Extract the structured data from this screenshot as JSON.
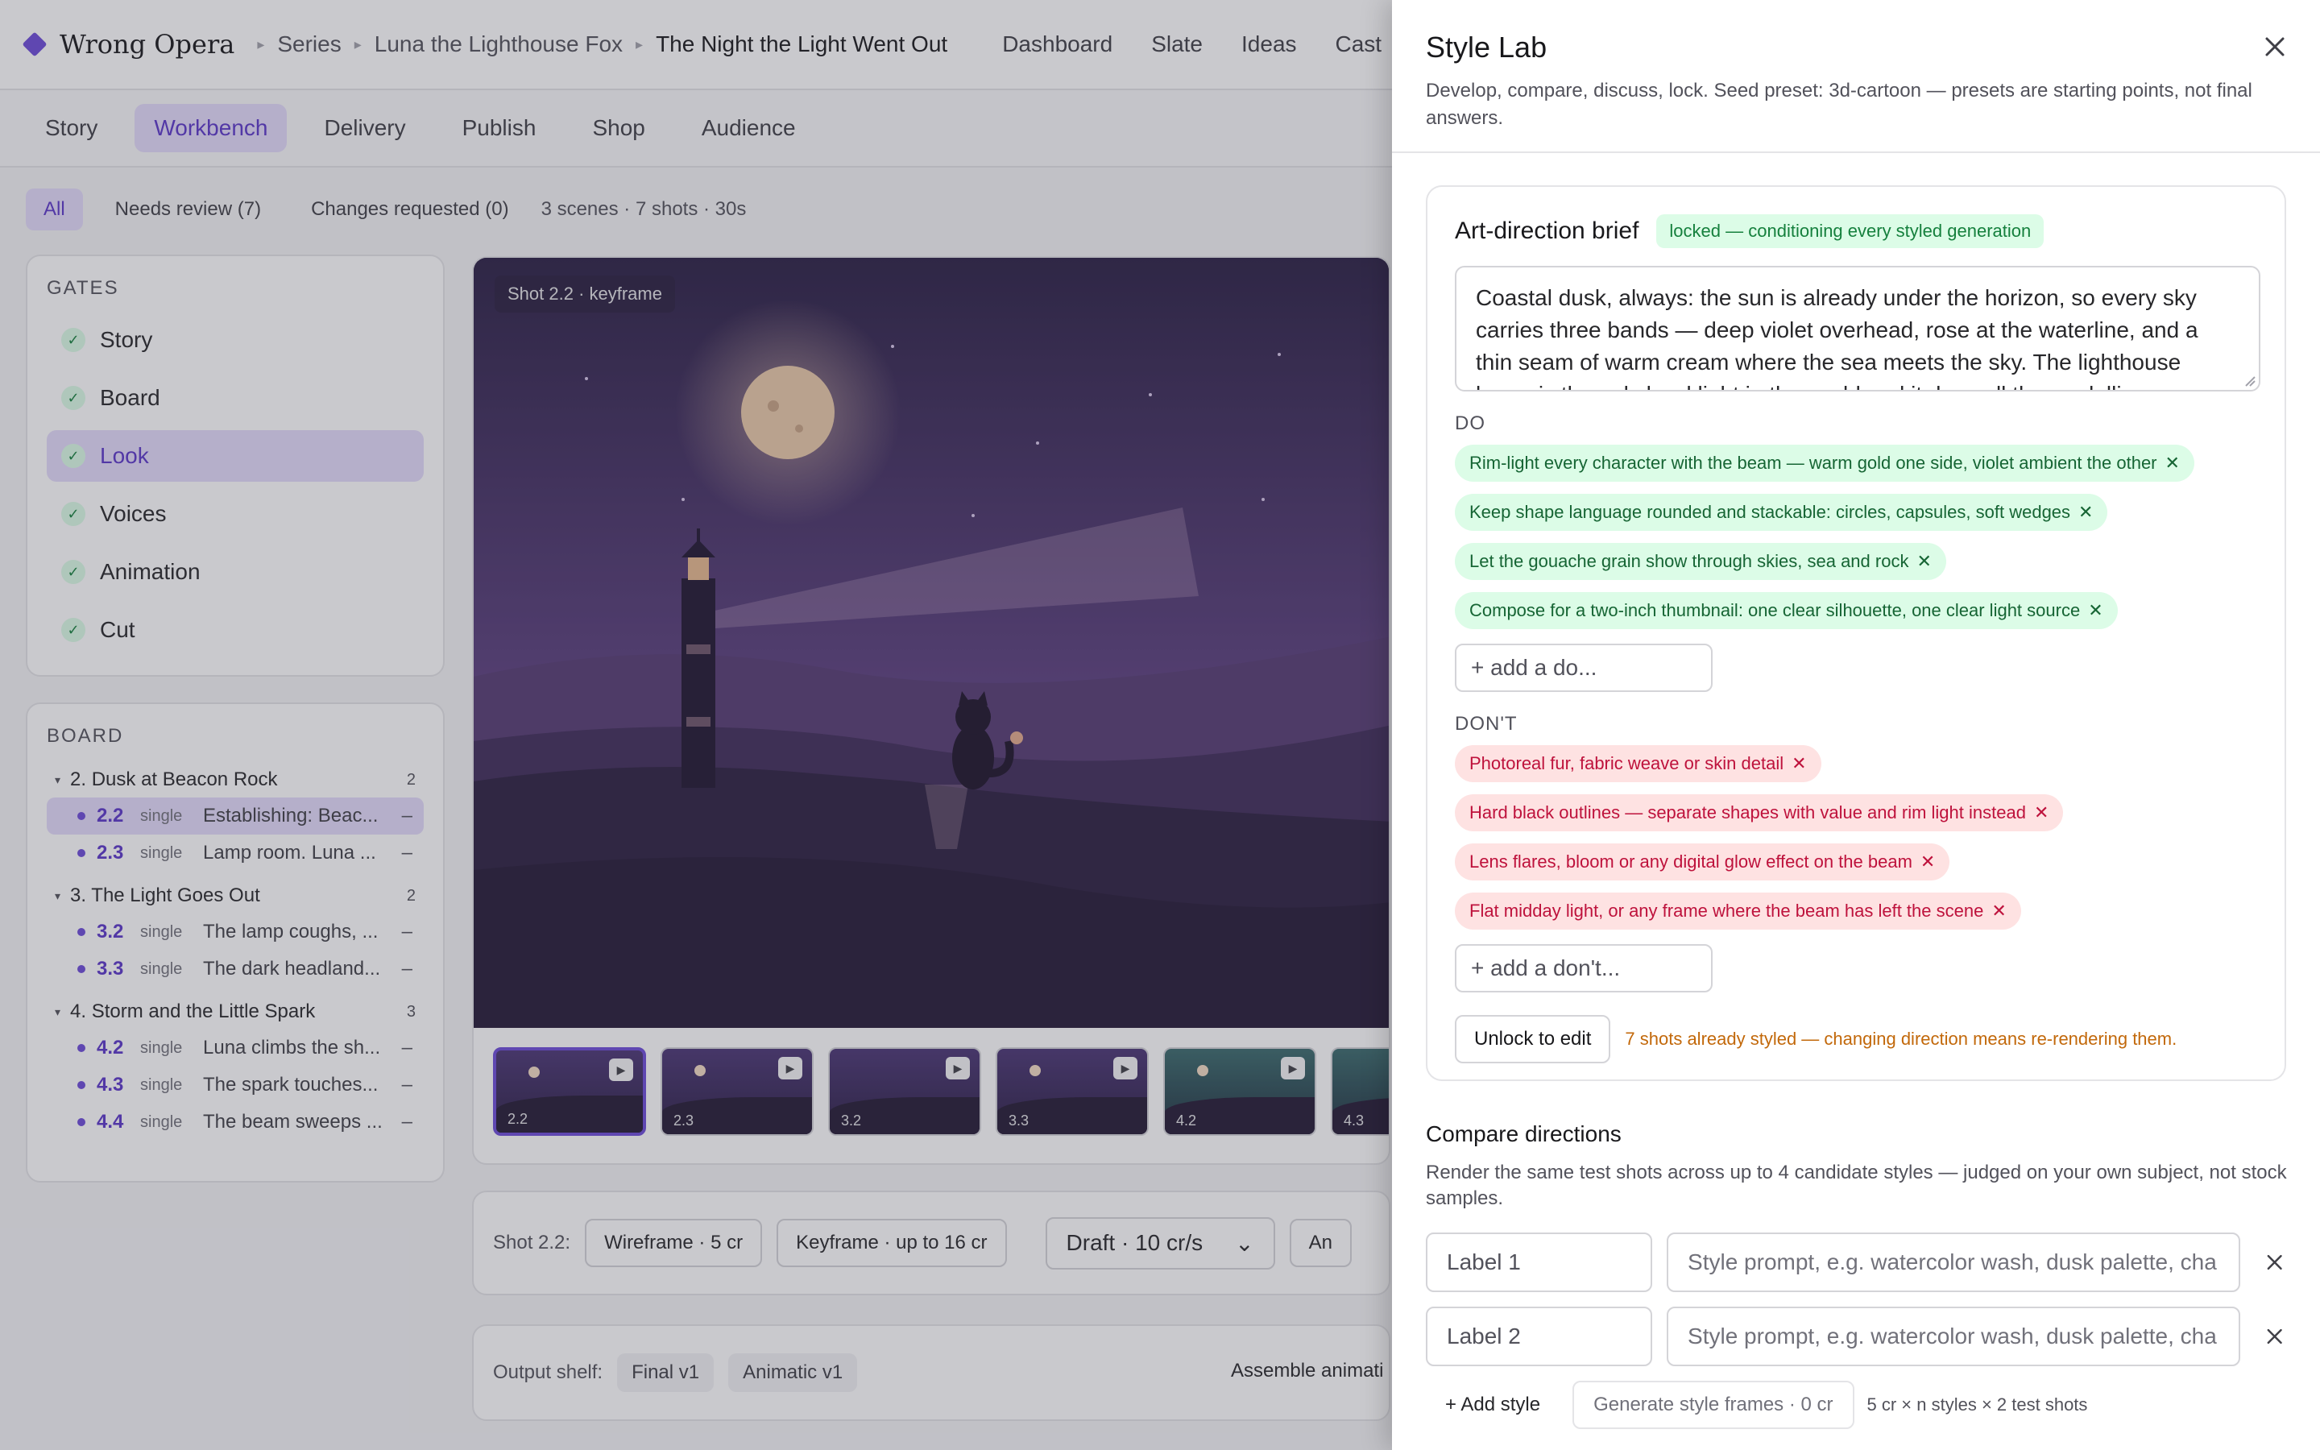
{
  "app": {
    "brand": "Wrong Opera",
    "breadcrumbs": [
      "Series",
      "Luna the Lighthouse Fox",
      "The Night the Light Went Out"
    ],
    "topnav": [
      "Dashboard",
      "Slate",
      "Ideas",
      "Cast"
    ]
  },
  "tabs": [
    "Story",
    "Workbench",
    "Delivery",
    "Publish",
    "Shop",
    "Audience"
  ],
  "filters": {
    "all": "All",
    "needs_review": "Needs review (7)",
    "changes": "Changes requested (0)",
    "meta": "3 scenes · 7 shots · 30s"
  },
  "gates": {
    "heading": "GATES",
    "items": [
      "Story",
      "Board",
      "Look",
      "Voices",
      "Animation",
      "Cut"
    ]
  },
  "board": {
    "heading": "BOARD",
    "scenes": [
      {
        "title": "2. Dusk at Beacon Rock",
        "count": "2",
        "shots": [
          {
            "id": "2.2",
            "type": "single",
            "title": "Establishing: Beac...",
            "dash": "–"
          },
          {
            "id": "2.3",
            "type": "single",
            "title": "Lamp room. Luna ...",
            "dash": "–"
          }
        ]
      },
      {
        "title": "3. The Light Goes Out",
        "count": "2",
        "shots": [
          {
            "id": "3.2",
            "type": "single",
            "title": "The lamp coughs, ...",
            "dash": "–"
          },
          {
            "id": "3.3",
            "type": "single",
            "title": "The dark headland...",
            "dash": "–"
          }
        ]
      },
      {
        "title": "4. Storm and the Little Spark",
        "count": "3",
        "shots": [
          {
            "id": "4.2",
            "type": "single",
            "title": "Luna climbs the sh...",
            "dash": "–"
          },
          {
            "id": "4.3",
            "type": "single",
            "title": "The spark touches...",
            "dash": "–"
          },
          {
            "id": "4.4",
            "type": "single",
            "title": "The beam sweeps ...",
            "dash": "–"
          }
        ]
      }
    ]
  },
  "viewer": {
    "frame_label": "Shot 2.2 · keyframe",
    "thumbs": [
      "2.2",
      "2.3",
      "3.2",
      "3.3",
      "4.2",
      "4.3"
    ]
  },
  "toolbar": {
    "label": "Shot 2.2:",
    "wireframe": "Wireframe · 5 cr",
    "keyframe": "Keyframe · up to 16 cr",
    "quality": "Draft · 10 cr/s",
    "cut": "An"
  },
  "shelf": {
    "label": "Output shelf:",
    "items": [
      "Final v1",
      "Animatic v1"
    ],
    "assemble": "Assemble animati"
  },
  "drawer": {
    "title": "Style Lab",
    "subtitle": "Develop, compare, discuss, lock. Seed preset: 3d-cartoon — presets are starting points, not final answers.",
    "brief": {
      "title": "Art-direction brief",
      "badge": "locked — conditioning every styled generation",
      "text": "Coastal dusk, always: the sun is already under the horizon, so every sky carries three bands — deep violet overhead, rose at the waterline, and a thin seam of warm cream where the sea meets the sky. The lighthouse beam is the only hard light in the world and it does all the modelling, so"
    },
    "do_label": "DO",
    "do_items": [
      "Rim-light every character with the beam — warm gold one side, violet ambient the other",
      "Keep shape language rounded and stackable: circles, capsules, soft wedges",
      "Let the gouache grain show through skies, sea and rock",
      "Compose for a two-inch thumbnail: one clear silhouette, one clear light source"
    ],
    "do_placeholder": "+ add a do...",
    "dont_label": "DON'T",
    "dont_items": [
      "Photoreal fur, fabric weave or skin detail",
      "Hard black outlines — separate shapes with value and rim light instead",
      "Lens flares, bloom or any digital glow effect on the beam",
      "Flat midday light, or any frame where the beam has left the scene"
    ],
    "dont_placeholder": "+ add a don't...",
    "unlock": "Unlock to edit",
    "warning": "7 shots already styled — changing direction means re-rendering them.",
    "compare": {
      "title": "Compare directions",
      "subtitle": "Render the same test shots across up to 4 candidate styles — judged on your own subject, not stock samples.",
      "rows": [
        {
          "label": "Label 1",
          "prompt": "Style prompt, e.g. watercolor wash, dusk palette, cha"
        },
        {
          "label": "Label 2",
          "prompt": "Style prompt, e.g. watercolor wash, dusk palette, cha"
        }
      ],
      "add": "+ Add style",
      "generate": "Generate style frames · 0 cr",
      "cost": "5 cr × n styles × 2 test shots"
    }
  },
  "colors": {
    "accent": "#6d4bd8",
    "do_bg": "#dcfce7",
    "dont_bg": "#fee2e2",
    "warning": "#c2680a"
  }
}
